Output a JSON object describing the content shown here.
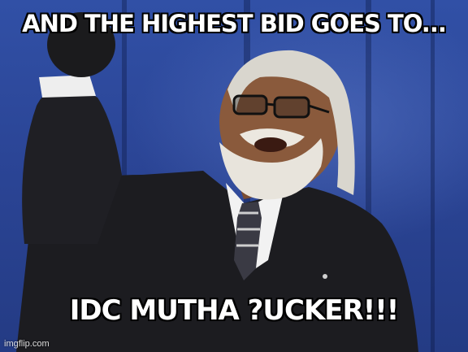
{
  "meme": {
    "top_text": "AND THE HIGHEST BID GOES TO...",
    "bottom_text": "IDC MUTHA ?UCKER!!!",
    "watermark": "imgflip.com"
  },
  "colors": {
    "background": "#2b4596",
    "suit": "#1c1c20",
    "skin": "#8a5a3c",
    "beard": "#e8e4dc",
    "caption": "#ffffff"
  }
}
